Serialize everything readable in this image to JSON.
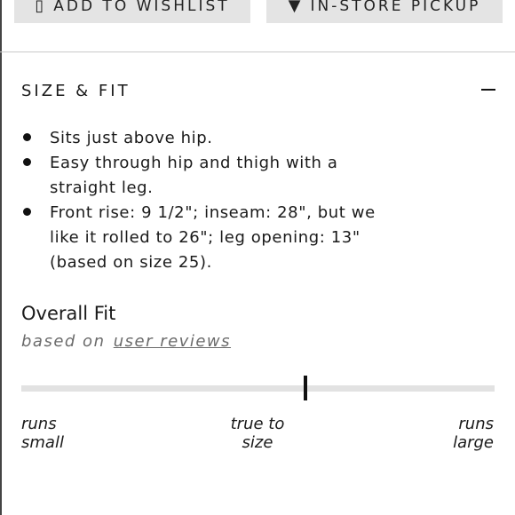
{
  "top_buttons": {
    "wishlist_label": "ADD TO WISHLIST",
    "wishlist_icon": "bookmark-icon",
    "pickup_label": "IN-STORE PICKUP",
    "pickup_icon": "location-pin-icon"
  },
  "size_fit": {
    "title": "SIZE & FIT",
    "collapse_icon": "minus-icon",
    "bullets": [
      "Sits just above hip.",
      "Easy through hip and thigh with a straight leg.",
      "Front rise: 9 1/2\"; inseam: 28\", but we like it rolled to 26\"; leg opening: 13\" (based on size 25)."
    ]
  },
  "overall_fit": {
    "title": "Overall Fit",
    "subtitle_prefix": "based on",
    "subtitle_link": "user reviews",
    "fit_value": 0.6,
    "scale": {
      "left_line1": "runs",
      "left_line2": "small",
      "mid_line1": "true to",
      "mid_line2": "size",
      "right_line1": "runs",
      "right_line2": "large"
    }
  },
  "colors": {
    "track": "#e2e2e2",
    "marker": "#111111",
    "button_bg": "#e4e4e4",
    "muted_text": "#6b6b6b"
  }
}
